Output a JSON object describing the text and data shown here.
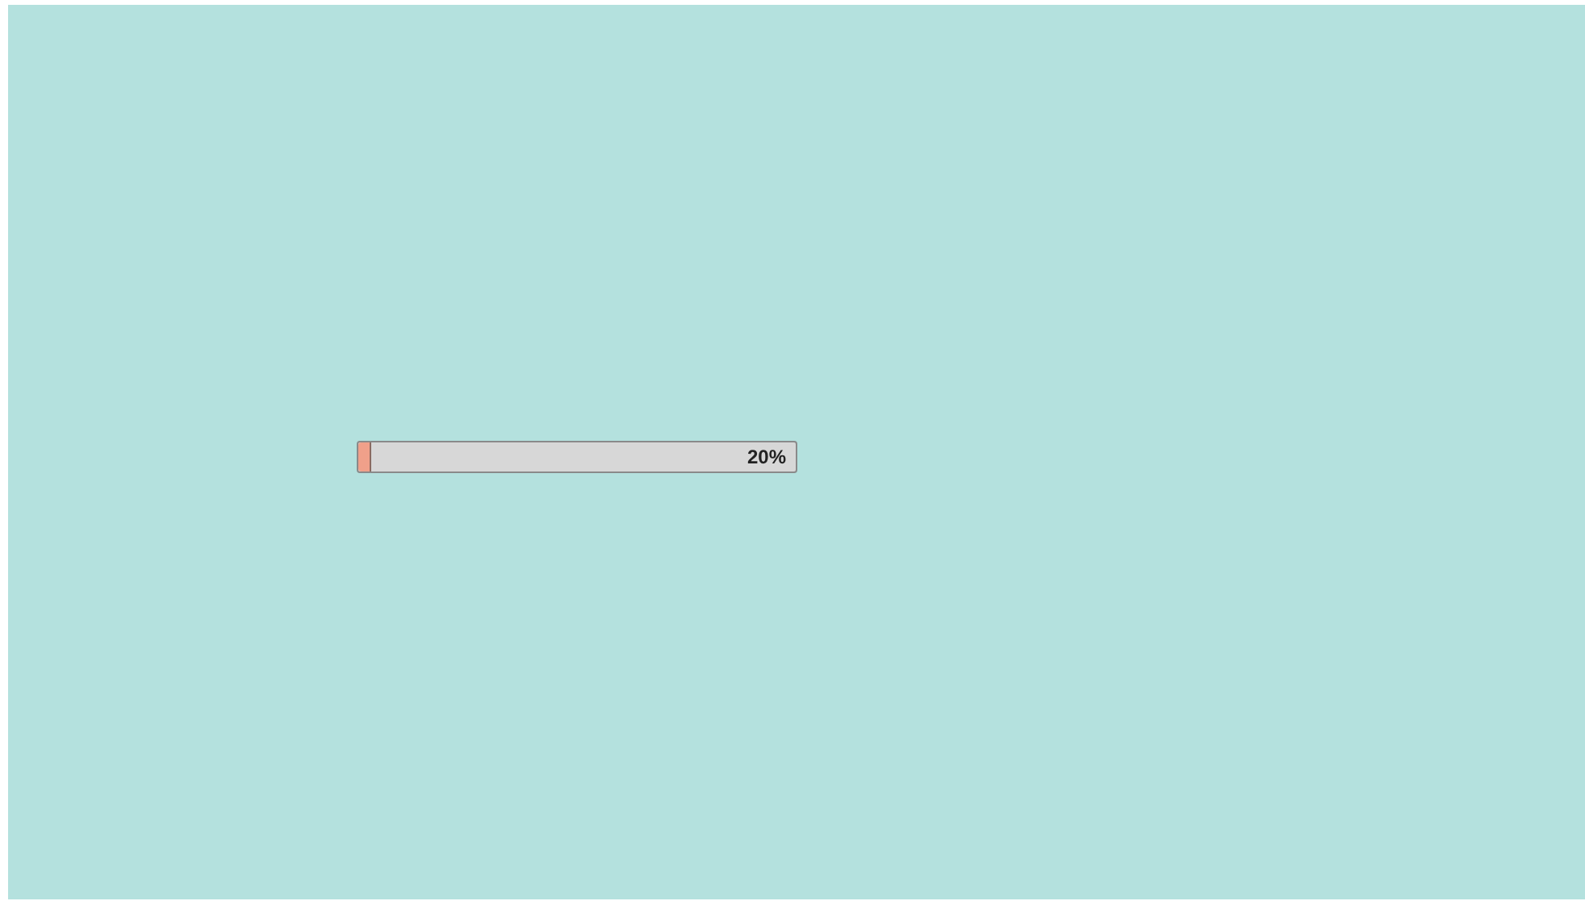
{
  "progress": {
    "level": 0.03,
    "reading": "20%"
  }
}
